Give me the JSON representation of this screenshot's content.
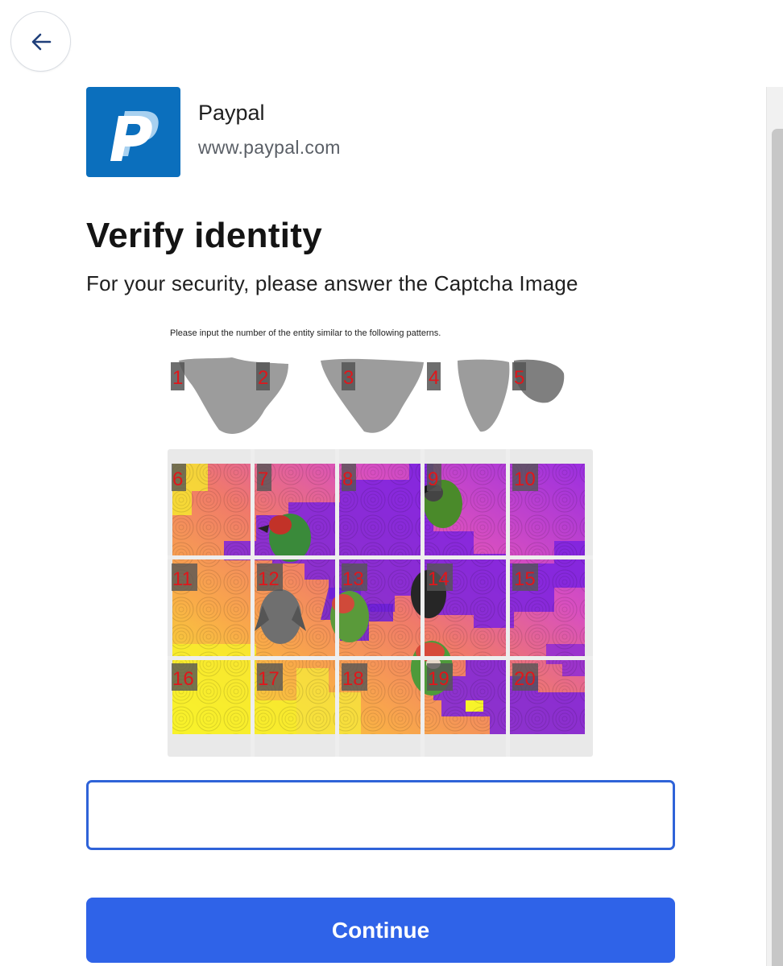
{
  "merchant": {
    "name": "Paypal",
    "url": "www.paypal.com",
    "logo_icon": "paypal-p-logo",
    "logo_color": "#0b6fbd"
  },
  "header": {
    "back_icon": "arrow-left-icon"
  },
  "main": {
    "title": "Verify identity",
    "subtitle": "For your security, please answer the Captcha Image"
  },
  "captcha": {
    "instruction": "Please input the number of the entity similar to the following patterns.",
    "pattern_numbers": [
      "1",
      "2",
      "3",
      "4",
      "5"
    ],
    "grid_numbers": [
      "6",
      "7",
      "8",
      "9",
      "10",
      "11",
      "12",
      "13",
      "14",
      "15",
      "16",
      "17",
      "18",
      "19",
      "20"
    ],
    "number_color": "#e0161b"
  },
  "answer": {
    "value": "",
    "placeholder": ""
  },
  "actions": {
    "continue_label": "Continue"
  },
  "colors": {
    "accent": "#2f63e8",
    "input_border": "#2f63d8"
  }
}
